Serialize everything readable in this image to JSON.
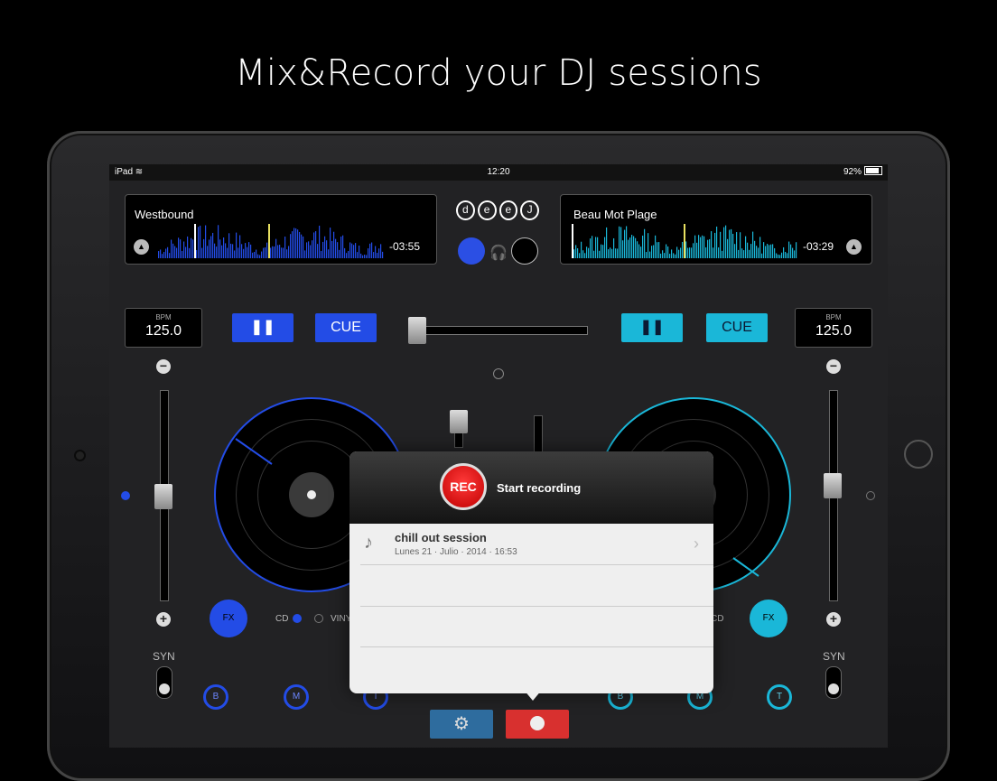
{
  "headline": "Mix&Record your DJ sessions",
  "status": {
    "device": "iPad",
    "time": "12:20",
    "battery": "92%"
  },
  "deckA": {
    "track": "Westbound",
    "remaining": "-03:55",
    "bpm_label": "BPM",
    "bpm": "125.0",
    "cue_label": "CUE",
    "fx_label": "FX",
    "cd_label": "CD",
    "vinyl_label": "VINYL",
    "syn_label": "SYN",
    "eq": [
      "B",
      "M",
      "T"
    ],
    "color": "#234ce6"
  },
  "deckB": {
    "track": "Beau Mot Plage",
    "remaining": "-03:29",
    "bpm_label": "BPM",
    "bpm": "125.0",
    "cue_label": "CUE",
    "fx_label": "FX",
    "cd_label": "CD",
    "syn_label": "SYN",
    "eq": [
      "B",
      "M",
      "T"
    ],
    "color": "#1ab7d8"
  },
  "logo": [
    "d",
    "e",
    "e",
    "J"
  ],
  "popup": {
    "rec_label": "REC",
    "start_label": "Start recording",
    "sessions": [
      {
        "title": "chill out session",
        "date": "Lunes 21 · Julio · 2014 · 16:53"
      }
    ]
  },
  "icons": {
    "pause": "pause-icon",
    "eject": "eject-icon",
    "headphones": "headphones-icon",
    "settings": "gear-icon",
    "record": "record-icon",
    "note": "music-note-icon"
  }
}
